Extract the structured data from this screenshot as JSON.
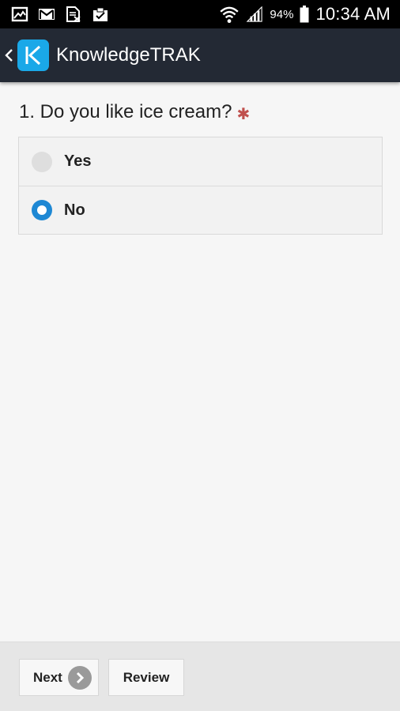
{
  "status_bar": {
    "battery_percent": "94%",
    "time": "10:34 AM",
    "icons": [
      "gallery-icon",
      "gmail-icon",
      "document-icon",
      "clipboard-icon",
      "wifi-icon",
      "signal-icon",
      "battery-icon"
    ]
  },
  "app_bar": {
    "title": "KnowledgeTRAK",
    "logo_letter": "K",
    "logo_color": "#1aa8e8",
    "background": "#232934"
  },
  "question": {
    "text": "1. Do you like ice cream?",
    "required_mark": "✱",
    "options": [
      {
        "label": "Yes",
        "selected": false
      },
      {
        "label": "No",
        "selected": true
      }
    ]
  },
  "footer": {
    "next_label": "Next",
    "review_label": "Review"
  },
  "colors": {
    "accent": "#1e88d4",
    "required": "#c0504d"
  }
}
